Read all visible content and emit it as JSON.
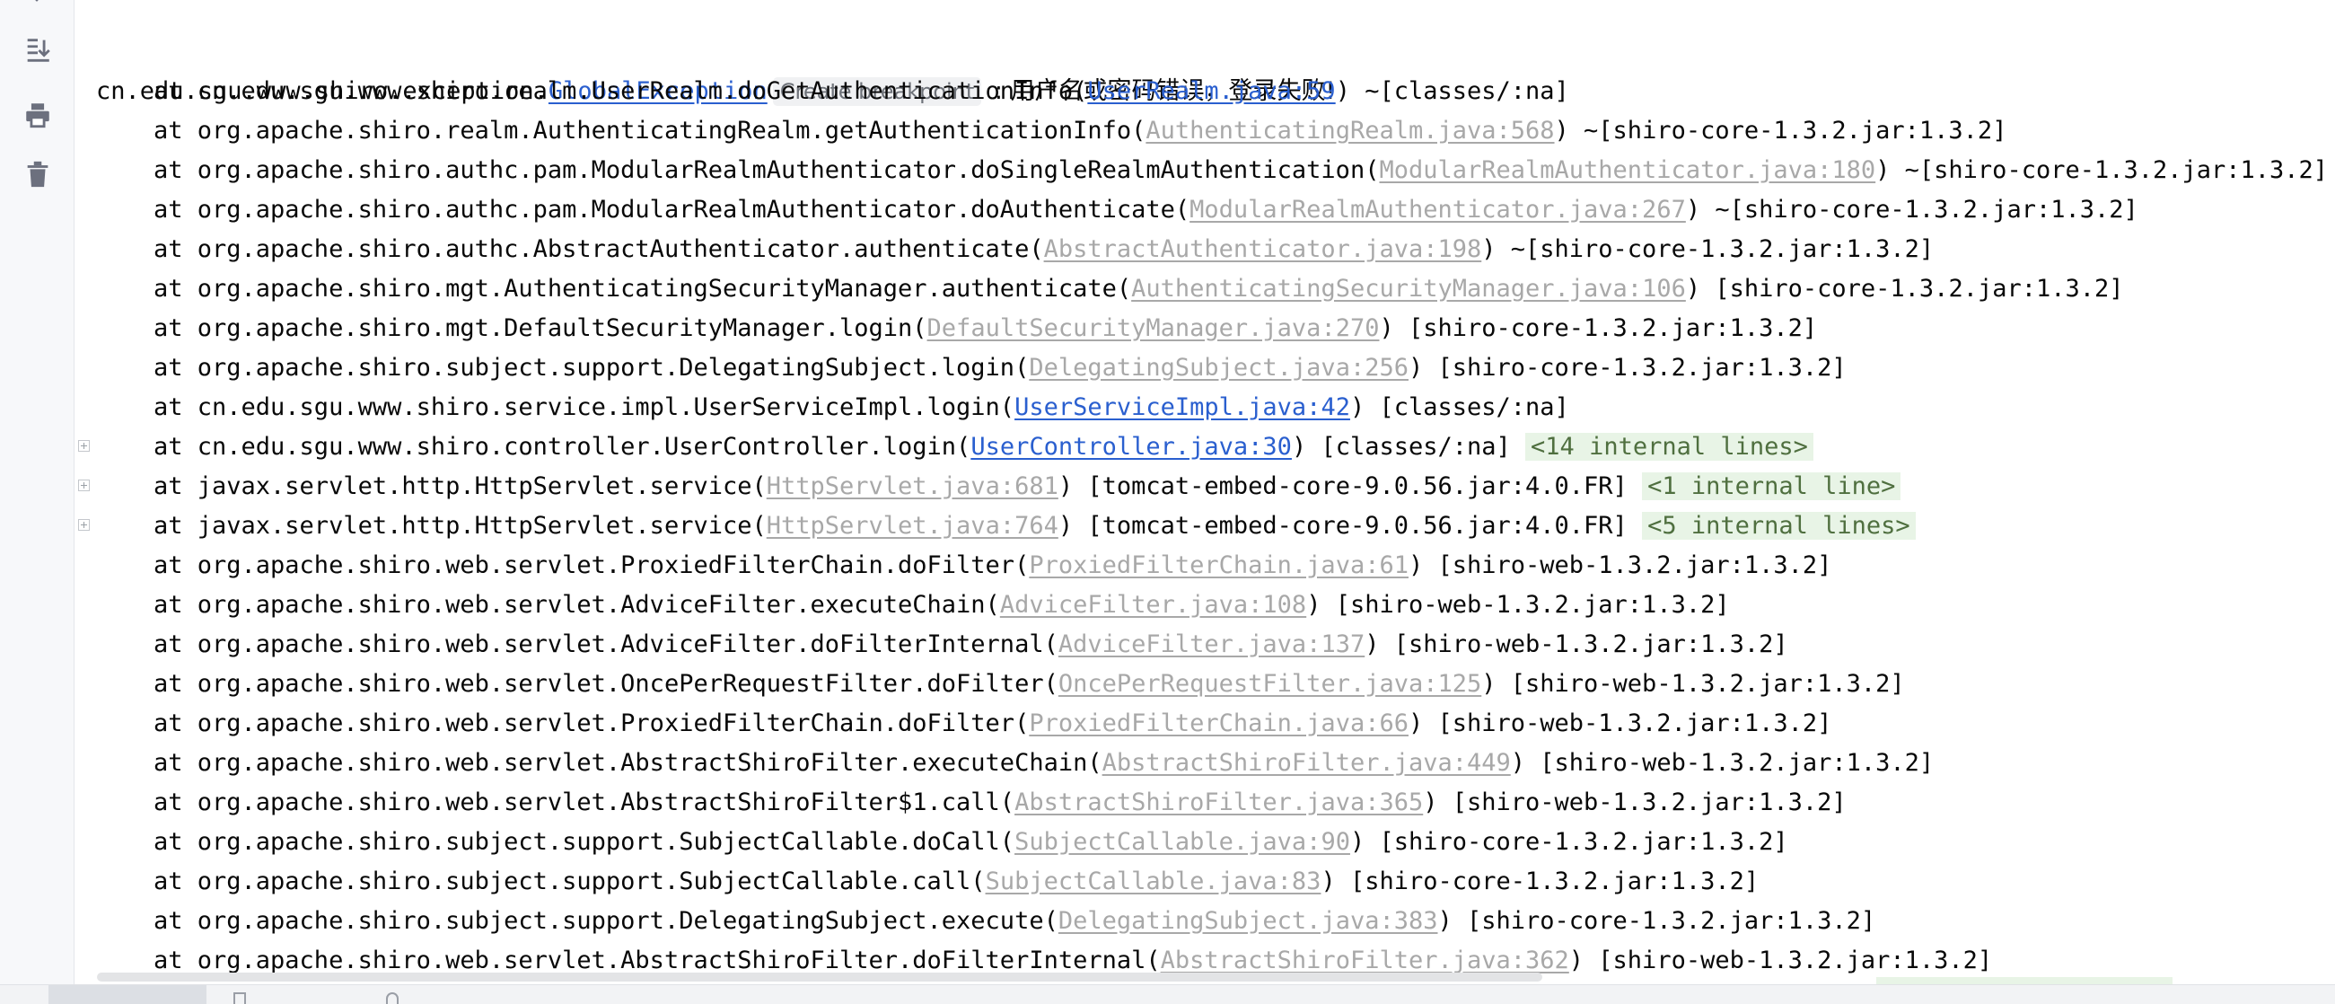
{
  "toolbar": {
    "icons": [
      "soft-wrap-icon",
      "scroll-to-end-icon",
      "print-icon",
      "trash-icon"
    ]
  },
  "console": {
    "header": {
      "prefix": "cn.edu.sgu.www.shiro.exception.",
      "link": "GlobalException",
      "breakpoint": "Create breakpoint",
      "message": " : 用户名或密码错误，登录失败!"
    },
    "frames": [
      {
        "pre": "at cn.edu.sgu.www.shiro.realm.UserRealm.doGetAuthenticationInfo(",
        "link": "UserRealm.java:59",
        "kind": "app",
        "post": ") ~[classes/:na]",
        "internal": "",
        "fold": false
      },
      {
        "pre": "at org.apache.shiro.realm.AuthenticatingRealm.getAuthenticationInfo(",
        "link": "AuthenticatingRealm.java:568",
        "kind": "lib",
        "post": ") ~[shiro-core-1.3.2.jar:1.3.2]",
        "internal": "",
        "fold": false
      },
      {
        "pre": "at org.apache.shiro.authc.pam.ModularRealmAuthenticator.doSingleRealmAuthentication(",
        "link": "ModularRealmAuthenticator.java:180",
        "kind": "lib",
        "post": ") ~[shiro-core-1.3.2.jar:1.3.2]",
        "internal": "",
        "fold": false
      },
      {
        "pre": "at org.apache.shiro.authc.pam.ModularRealmAuthenticator.doAuthenticate(",
        "link": "ModularRealmAuthenticator.java:267",
        "kind": "lib",
        "post": ") ~[shiro-core-1.3.2.jar:1.3.2]",
        "internal": "",
        "fold": false
      },
      {
        "pre": "at org.apache.shiro.authc.AbstractAuthenticator.authenticate(",
        "link": "AbstractAuthenticator.java:198",
        "kind": "lib",
        "post": ") ~[shiro-core-1.3.2.jar:1.3.2]",
        "internal": "",
        "fold": false
      },
      {
        "pre": "at org.apache.shiro.mgt.AuthenticatingSecurityManager.authenticate(",
        "link": "AuthenticatingSecurityManager.java:106",
        "kind": "lib",
        "post": ") [shiro-core-1.3.2.jar:1.3.2]",
        "internal": "",
        "fold": false
      },
      {
        "pre": "at org.apache.shiro.mgt.DefaultSecurityManager.login(",
        "link": "DefaultSecurityManager.java:270",
        "kind": "lib",
        "post": ") [shiro-core-1.3.2.jar:1.3.2]",
        "internal": "",
        "fold": false
      },
      {
        "pre": "at org.apache.shiro.subject.support.DelegatingSubject.login(",
        "link": "DelegatingSubject.java:256",
        "kind": "lib",
        "post": ") [shiro-core-1.3.2.jar:1.3.2]",
        "internal": "",
        "fold": false
      },
      {
        "pre": "at cn.edu.sgu.www.shiro.service.impl.UserServiceImpl.login(",
        "link": "UserServiceImpl.java:42",
        "kind": "app",
        "post": ") [classes/:na]",
        "internal": "",
        "fold": false
      },
      {
        "pre": "at cn.edu.sgu.www.shiro.controller.UserController.login(",
        "link": "UserController.java:30",
        "kind": "app",
        "post": ") [classes/:na]",
        "internal": "<14 internal lines>",
        "fold": true
      },
      {
        "pre": "at javax.servlet.http.HttpServlet.service(",
        "link": "HttpServlet.java:681",
        "kind": "lib",
        "post": ") [tomcat-embed-core-9.0.56.jar:4.0.FR]",
        "internal": "<1 internal line>",
        "fold": true
      },
      {
        "pre": "at javax.servlet.http.HttpServlet.service(",
        "link": "HttpServlet.java:764",
        "kind": "lib",
        "post": ") [tomcat-embed-core-9.0.56.jar:4.0.FR]",
        "internal": "<5 internal lines>",
        "fold": true
      },
      {
        "pre": "at org.apache.shiro.web.servlet.ProxiedFilterChain.doFilter(",
        "link": "ProxiedFilterChain.java:61",
        "kind": "lib",
        "post": ") [shiro-web-1.3.2.jar:1.3.2]",
        "internal": "",
        "fold": false
      },
      {
        "pre": "at org.apache.shiro.web.servlet.AdviceFilter.executeChain(",
        "link": "AdviceFilter.java:108",
        "kind": "lib",
        "post": ") [shiro-web-1.3.2.jar:1.3.2]",
        "internal": "",
        "fold": false
      },
      {
        "pre": "at org.apache.shiro.web.servlet.AdviceFilter.doFilterInternal(",
        "link": "AdviceFilter.java:137",
        "kind": "lib",
        "post": ") [shiro-web-1.3.2.jar:1.3.2]",
        "internal": "",
        "fold": false
      },
      {
        "pre": "at org.apache.shiro.web.servlet.OncePerRequestFilter.doFilter(",
        "link": "OncePerRequestFilter.java:125",
        "kind": "lib",
        "post": ") [shiro-web-1.3.2.jar:1.3.2]",
        "internal": "",
        "fold": false
      },
      {
        "pre": "at org.apache.shiro.web.servlet.ProxiedFilterChain.doFilter(",
        "link": "ProxiedFilterChain.java:66",
        "kind": "lib",
        "post": ") [shiro-web-1.3.2.jar:1.3.2]",
        "internal": "",
        "fold": false
      },
      {
        "pre": "at org.apache.shiro.web.servlet.AbstractShiroFilter.executeChain(",
        "link": "AbstractShiroFilter.java:449",
        "kind": "lib",
        "post": ") [shiro-web-1.3.2.jar:1.3.2]",
        "internal": "",
        "fold": false
      },
      {
        "pre": "at org.apache.shiro.web.servlet.AbstractShiroFilter$1.call(",
        "link": "AbstractShiroFilter.java:365",
        "kind": "lib",
        "post": ") [shiro-web-1.3.2.jar:1.3.2]",
        "internal": "",
        "fold": false
      },
      {
        "pre": "at org.apache.shiro.subject.support.SubjectCallable.doCall(",
        "link": "SubjectCallable.java:90",
        "kind": "lib",
        "post": ") [shiro-core-1.3.2.jar:1.3.2]",
        "internal": "",
        "fold": false
      },
      {
        "pre": "at org.apache.shiro.subject.support.SubjectCallable.call(",
        "link": "SubjectCallable.java:83",
        "kind": "lib",
        "post": ") [shiro-core-1.3.2.jar:1.3.2]",
        "internal": "",
        "fold": false
      },
      {
        "pre": "at org.apache.shiro.subject.support.DelegatingSubject.execute(",
        "link": "DelegatingSubject.java:383",
        "kind": "lib",
        "post": ") [shiro-core-1.3.2.jar:1.3.2]",
        "internal": "",
        "fold": false
      },
      {
        "pre": "at org.apache.shiro.web.servlet.AbstractShiroFilter.doFilterInternal(",
        "link": "AbstractShiroFilter.java:362",
        "kind": "lib",
        "post": ") [shiro-web-1.3.2.jar:1.3.2]",
        "internal": "",
        "fold": false
      }
    ]
  },
  "colors": {
    "app_link": "#2a5fcf",
    "lib_link": "#a8a8a8",
    "internal_bg": "#e8f4e6",
    "text": "#080808"
  }
}
